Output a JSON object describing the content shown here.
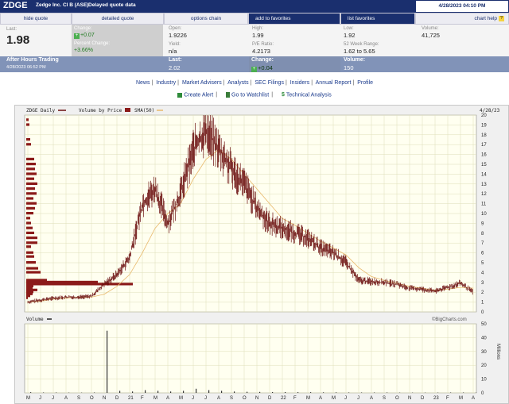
{
  "header": {
    "ticker": "ZDGE",
    "company": "Zedge Inc. Cl B (ASE)",
    "delayed": "Delayed quote data",
    "datetime": "4/28/2023 04:10 PM"
  },
  "tabs": {
    "hide_quote": "hide quote",
    "detailed_quote": "detailed quote",
    "options_chain": "options chain",
    "add_favorites": "add to favorites",
    "list_favorites": "list favorites",
    "chart_help": "chart help",
    "help_icon": "?"
  },
  "quote": {
    "last_label": "Last:",
    "last_value": "1.98",
    "change_label": "Change:",
    "change_value": "+0.07",
    "pct_label": "Percent Change:",
    "pct_value": "+3.66%",
    "open_label": "Open:",
    "open_value": "1.9226",
    "yield_label": "Yield:",
    "yield_value": "n/a",
    "high_label": "High:",
    "high_value": "1.99",
    "pe_label": "P/E Ratio:",
    "pe_value": "4.2173",
    "low_label": "Low:",
    "low_value": "1.92",
    "wk52_label": "52 Week Range:",
    "wk52_value": "1.62 to 5.65",
    "volume_label": "Volume:",
    "volume_value": "41,725"
  },
  "after_hours": {
    "title": "After Hours Trading",
    "stamp": "4/28/2023 06:52 PM",
    "last_label": "Last:",
    "last_value": "2.02",
    "change_label": "Change:",
    "change_value": "+0.04",
    "volume_label": "Volume:",
    "volume_value": "150"
  },
  "links": {
    "row1": [
      "News",
      "Industry",
      "Market Advisers",
      "Analysts",
      "SEC Filings",
      "Insiders",
      "Annual Report",
      "Profile"
    ],
    "separator": "|",
    "create_alert": "Create Alert",
    "go_watchlist": "Go to Watchlist",
    "technical": "Technical Analysis",
    "dollar_icon": "$"
  },
  "chart": {
    "legend_daily": "ZDGE Daily",
    "legend_vbp": "Volume by Price",
    "legend_sma": "SMA(50)",
    "date_label": "4/28/23",
    "volume_label": "Volume",
    "watermark": "©BigCharts.com",
    "millions_label": "Millions",
    "price_ticks": [
      "20",
      "19",
      "18",
      "17",
      "16",
      "15",
      "14",
      "13",
      "12",
      "11",
      "10",
      "9",
      "8",
      "7",
      "6",
      "5",
      "4",
      "3",
      "2",
      "1",
      "0"
    ],
    "volume_ticks": [
      "50",
      "40",
      "30",
      "20",
      "10",
      "0"
    ],
    "month_ticks": [
      "M",
      "J",
      "J",
      "A",
      "S",
      "O",
      "N",
      "D",
      "21",
      "F",
      "M",
      "A",
      "M",
      "J",
      "J",
      "A",
      "S",
      "O",
      "N",
      "D",
      "22",
      "F",
      "M",
      "A",
      "M",
      "J",
      "J",
      "A",
      "S",
      "O",
      "N",
      "D",
      "23",
      "F",
      "M",
      "A"
    ]
  },
  "chart_data": {
    "type": "line",
    "title": "ZDGE Daily",
    "legend": [
      "ZDGE Daily",
      "Volume by Price",
      "SMA(50)"
    ],
    "x": [
      "2020-05",
      "2020-06",
      "2020-07",
      "2020-08",
      "2020-09",
      "2020-10",
      "2020-11",
      "2020-12",
      "2021-01",
      "2021-02",
      "2021-03",
      "2021-04",
      "2021-05",
      "2021-06",
      "2021-07",
      "2021-08",
      "2021-09",
      "2021-10",
      "2021-11",
      "2021-12",
      "2022-01",
      "2022-02",
      "2022-03",
      "2022-04",
      "2022-05",
      "2022-06",
      "2022-07",
      "2022-08",
      "2022-09",
      "2022-10",
      "2022-11",
      "2022-12",
      "2023-01",
      "2023-02",
      "2023-03",
      "2023-04"
    ],
    "series": [
      {
        "name": "ZDGE Daily",
        "values": [
          1.0,
          1.2,
          1.4,
          1.5,
          1.5,
          1.6,
          2.8,
          3.8,
          5.5,
          11.0,
          12.5,
          9.0,
          12.0,
          16.5,
          18.5,
          16.5,
          14.5,
          13.0,
          10.5,
          9.0,
          8.5,
          8.0,
          7.5,
          6.5,
          6.0,
          5.0,
          3.2,
          3.1,
          3.0,
          2.8,
          2.4,
          2.3,
          2.1,
          2.5,
          2.9,
          2.0
        ]
      },
      {
        "name": "SMA(50)",
        "values": [
          1.0,
          1.1,
          1.3,
          1.4,
          1.5,
          1.5,
          1.8,
          2.6,
          3.8,
          6.0,
          8.5,
          10.0,
          11.0,
          13.5,
          15.5,
          16.5,
          15.5,
          14.0,
          12.5,
          11.0,
          9.5,
          8.8,
          8.0,
          7.2,
          6.5,
          5.8,
          4.5,
          3.6,
          3.2,
          2.9,
          2.6,
          2.4,
          2.2,
          2.3,
          2.5,
          2.4
        ]
      }
    ],
    "volume_millions": [
      0.5,
      0.3,
      0.3,
      0.2,
      0.2,
      0.3,
      45,
      1.5,
      1,
      2,
      1.5,
      1,
      1.5,
      3,
      2,
      1.5,
      1,
      0.8,
      0.7,
      0.6,
      0.6,
      0.5,
      0.5,
      0.4,
      0.4,
      0.3,
      0.3,
      0.3,
      0.3,
      0.2,
      0.2,
      0.2,
      0.2,
      0.3,
      0.3,
      0.2
    ],
    "volume_by_price": [
      {
        "price": 1.4,
        "len": 2
      },
      {
        "price": 1.6,
        "len": 5
      },
      {
        "price": 1.8,
        "len": 8
      },
      {
        "price": 2.0,
        "len": 9
      },
      {
        "price": 2.2,
        "len": 14
      },
      {
        "price": 2.4,
        "len": 8
      },
      {
        "price": 2.6,
        "len": 9
      },
      {
        "price": 2.8,
        "len": 134
      },
      {
        "price": 3.0,
        "len": 90
      },
      {
        "price": 3.2,
        "len": 26
      },
      {
        "price": 4.0,
        "len": 18
      },
      {
        "price": 4.4,
        "len": 15
      },
      {
        "price": 5.0,
        "len": 12
      },
      {
        "price": 5.6,
        "len": 10
      },
      {
        "price": 6.0,
        "len": 9
      },
      {
        "price": 6.6,
        "len": 6
      },
      {
        "price": 7.0,
        "len": 14
      },
      {
        "price": 7.5,
        "len": 14
      },
      {
        "price": 8.0,
        "len": 10
      },
      {
        "price": 8.5,
        "len": 8
      },
      {
        "price": 9.0,
        "len": 6
      },
      {
        "price": 9.5,
        "len": 5
      },
      {
        "price": 10.0,
        "len": 9
      },
      {
        "price": 10.5,
        "len": 11
      },
      {
        "price": 11.0,
        "len": 13
      },
      {
        "price": 11.5,
        "len": 9
      },
      {
        "price": 12.0,
        "len": 13
      },
      {
        "price": 12.5,
        "len": 11
      },
      {
        "price": 13.0,
        "len": 14
      },
      {
        "price": 13.5,
        "len": 10
      },
      {
        "price": 14.0,
        "len": 13
      },
      {
        "price": 14.5,
        "len": 11
      },
      {
        "price": 15.0,
        "len": 12
      },
      {
        "price": 15.5,
        "len": 10
      },
      {
        "price": 17.0,
        "len": 6
      },
      {
        "price": 17.5,
        "len": 5
      },
      {
        "price": 19.0,
        "len": 4
      },
      {
        "price": 19.5,
        "len": 3
      }
    ],
    "y_price_range": [
      0,
      20
    ],
    "y_volume_range": [
      0,
      50
    ],
    "grid": true,
    "colors": {
      "price": "#6b0f0f",
      "sma": "#e8b86a",
      "vbp": "#8b1a1a",
      "volume": "#333333",
      "grid_bg": "#fffff0",
      "grid_line": "#dedeb8"
    }
  }
}
